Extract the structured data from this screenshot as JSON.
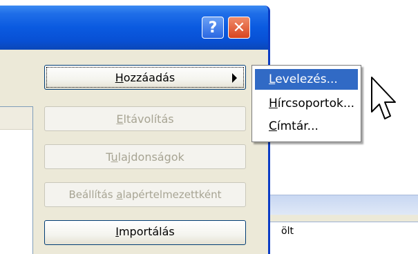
{
  "window": {
    "help_label": "?",
    "close_label": "✕"
  },
  "buttons": {
    "add": {
      "pre": "",
      "ul": "H",
      "post": "ozzáadás"
    },
    "remove": {
      "pre": "",
      "ul": "E",
      "post": "ltávolítás"
    },
    "properties": {
      "pre": "T",
      "ul": "u",
      "post": "lajdonságok"
    },
    "set_default": {
      "pre": "Beállítás ",
      "ul": "a",
      "post": "lapértelmezettként"
    },
    "import": {
      "pre": "",
      "ul": "I",
      "post": "mportálás"
    }
  },
  "menu": {
    "items": [
      {
        "pre": "",
        "ul": "L",
        "post": "evelezés..."
      },
      {
        "pre": "",
        "ul": "H",
        "post": "írcsoportok..."
      },
      {
        "pre": "",
        "ul": "C",
        "post": "ímtár..."
      }
    ]
  },
  "background_text": "ölt"
}
